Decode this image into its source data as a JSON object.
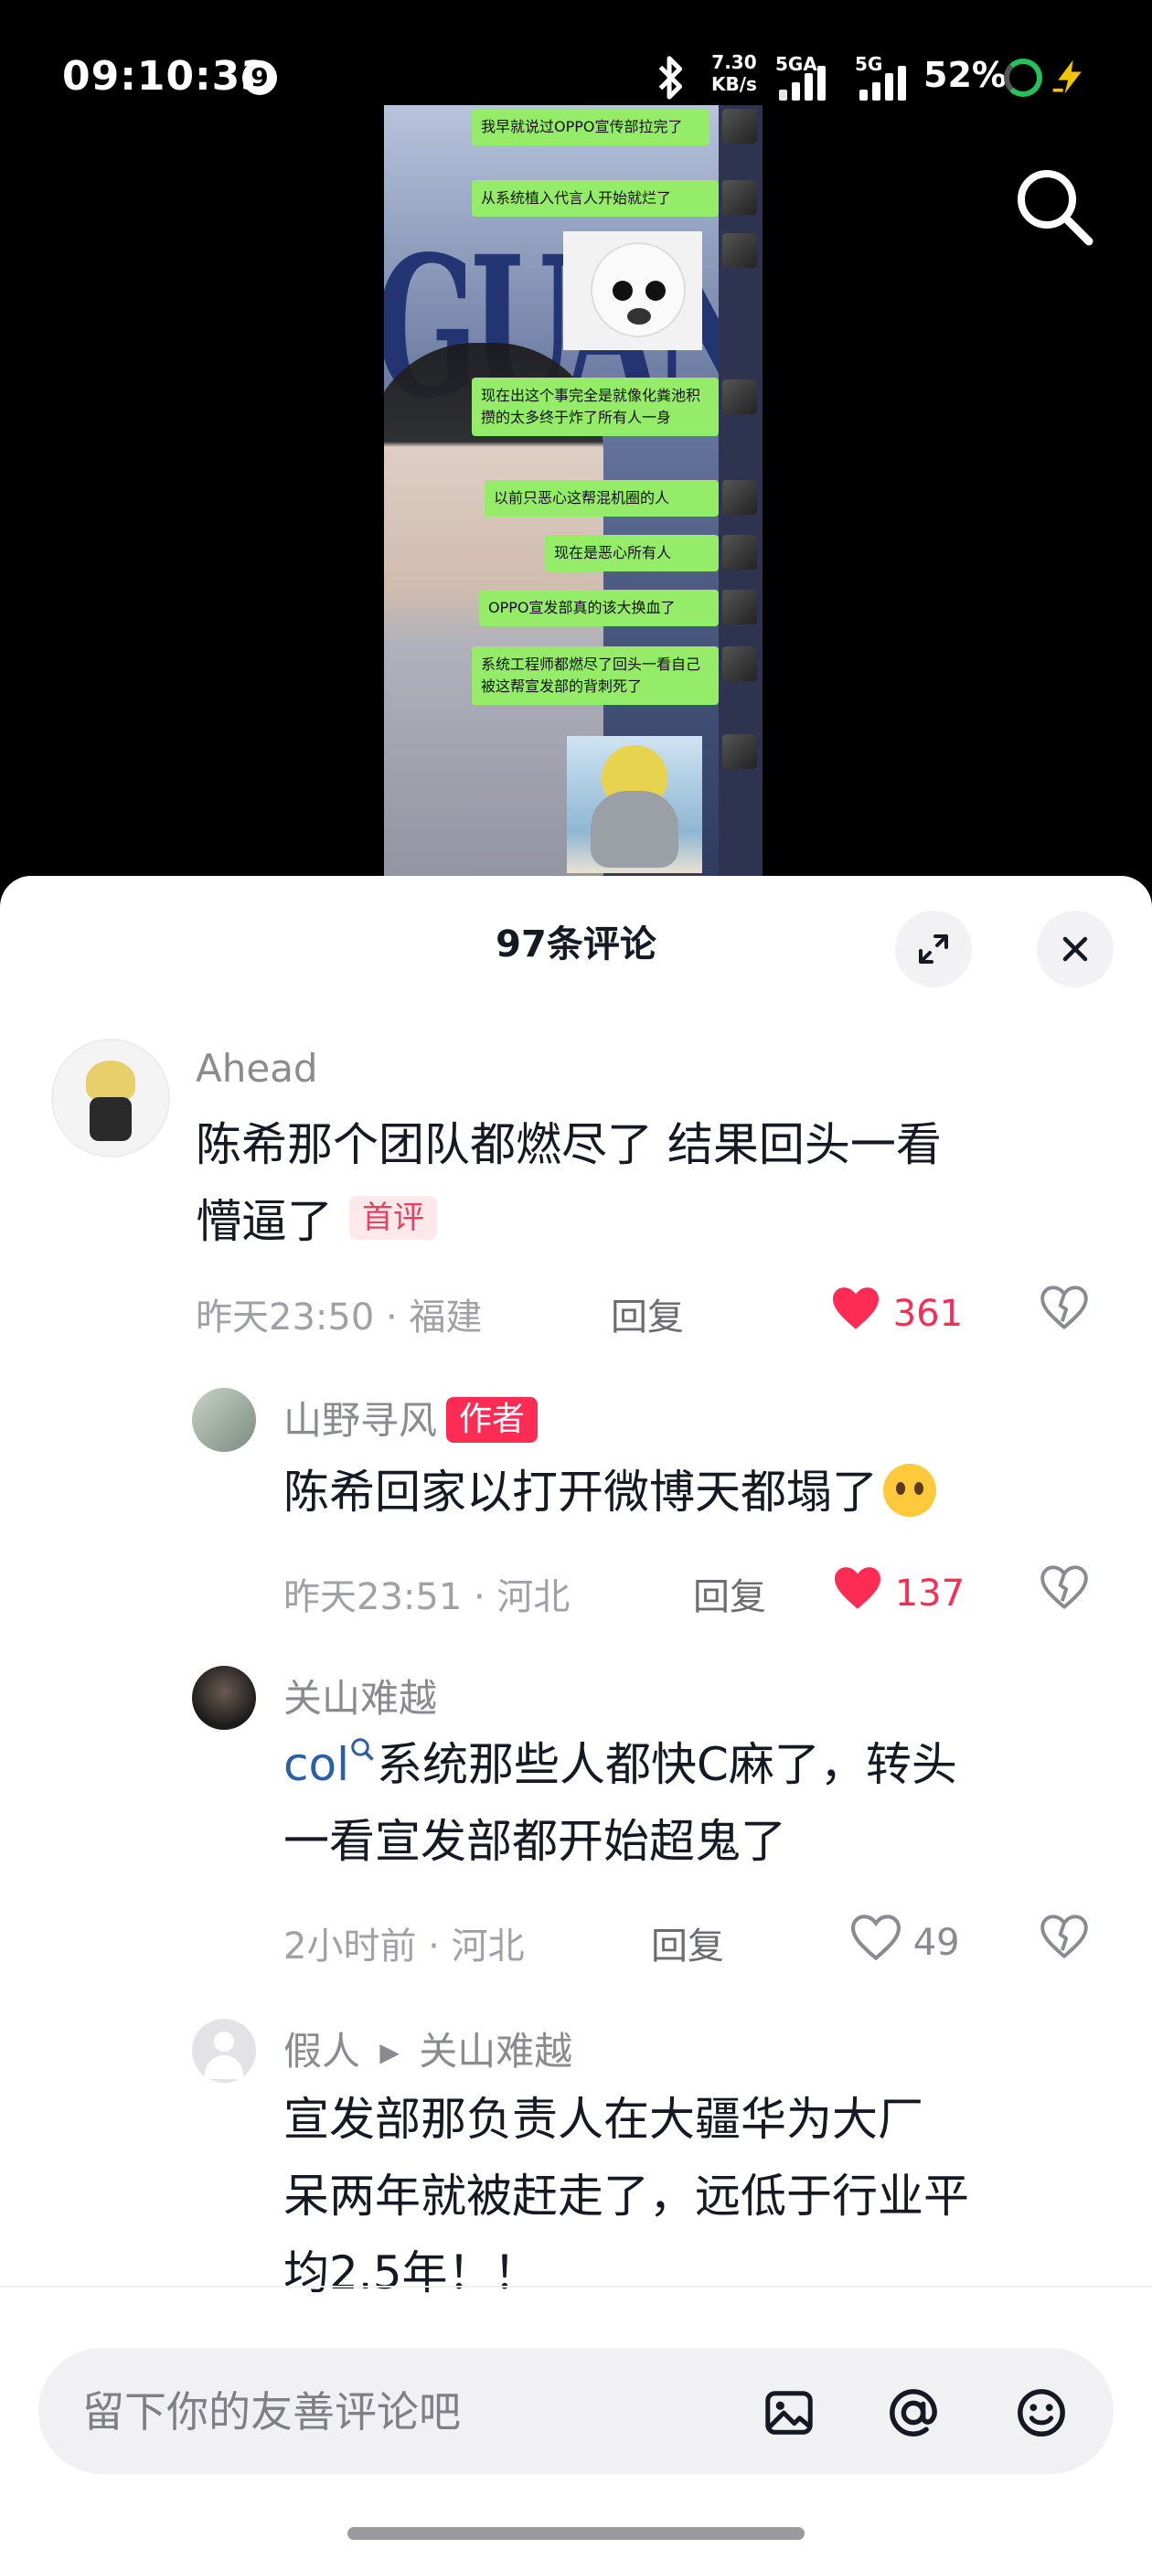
{
  "status_bar": {
    "time": "09:10:33",
    "notification_count": "9",
    "net_speed_value": "7.30",
    "net_speed_unit": "KB/s",
    "network_1": "5GA",
    "network_2": "5G",
    "battery": "52%"
  },
  "video": {
    "bg_text": "GUANYUAN",
    "messages": [
      "我早就说过OPPO宣传部拉完了",
      "从系统植入代言人开始就烂了",
      "现在出这个事完全是就像化粪池积攒的太多终于炸了所有人一身",
      "以前只恶心这帮混机圈的人",
      "现在是恶心所有人",
      "OPPO宣发部真的该大换血了",
      "系统工程师都燃尽了回头一看自己被这帮宣发部的背刺死了"
    ]
  },
  "panel": {
    "title": "97条评论"
  },
  "comments": [
    {
      "nickname": "Ahead",
      "text_line1": "陈希那个团队都燃尽了 结果回头一看",
      "text_line2": "懵逼了",
      "tag": "首评",
      "time_location": "昨天23:50 · 福建",
      "reply_label": "回复",
      "likes": "361"
    },
    {
      "nickname": "山野寻风",
      "author_tag": "作者",
      "text": "陈希回家以打开微博天都塌了",
      "time_location": "昨天23:51 · 河北",
      "reply_label": "回复",
      "likes": "137"
    },
    {
      "nickname": "关山难越",
      "mention": "col",
      "text_line1": "系统那些人都快C麻了，转头",
      "text_line2": "一看宣发部都开始超鬼了",
      "time_location": "2小时前 · 河北",
      "reply_label": "回复",
      "likes": "49"
    },
    {
      "nickname": "假人",
      "reply_to": "关山难越",
      "text_line1": "宣发部那负责人在大疆华为大厂",
      "text_line2": "呆两年就被赶走了，远低于行业平",
      "text_line3": "均2.5年！！"
    }
  ],
  "input": {
    "placeholder": "留下你的友善评论吧"
  },
  "colors": {
    "like_red": "#fe2c55",
    "bubble_green": "#95ec69",
    "mention_blue": "#2b5fa8"
  },
  "icons": [
    "search-icon",
    "expand-icon",
    "close-icon",
    "heart-icon",
    "dislike-heart-icon",
    "image-icon",
    "at-icon",
    "emoji-icon"
  ]
}
